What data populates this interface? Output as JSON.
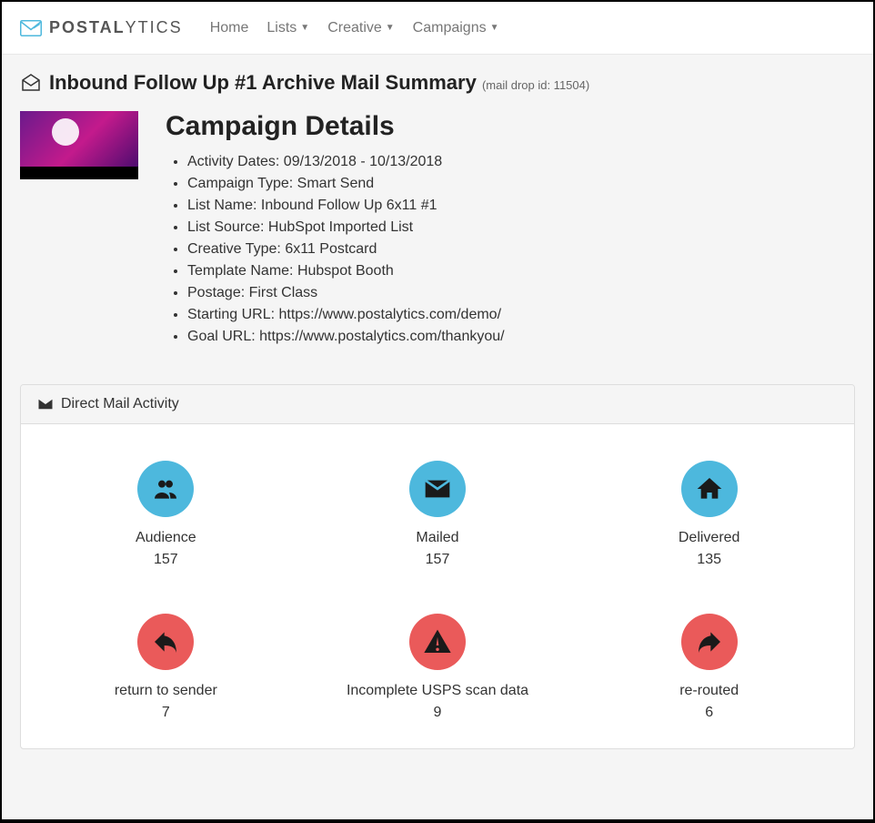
{
  "nav": {
    "home": "Home",
    "lists": "Lists",
    "creative": "Creative",
    "campaigns": "Campaigns"
  },
  "logo": {
    "main": "POSTAL",
    "sub": "YTICS"
  },
  "page": {
    "title": "Inbound Follow Up #1 Archive Mail Summary",
    "subtitle": "(mail drop id: 11504)"
  },
  "details": {
    "heading": "Campaign Details",
    "items": [
      "Activity Dates: 09/13/2018 - 10/13/2018",
      "Campaign Type: Smart Send",
      "List Name: Inbound Follow Up 6x11 #1",
      "List Source: HubSpot Imported List",
      "Creative Type: 6x11 Postcard",
      "Template Name: Hubspot Booth",
      "Postage: First Class",
      "Starting URL: https://www.postalytics.com/demo/",
      "Goal URL: https://www.postalytics.com/thankyou/"
    ]
  },
  "panel": {
    "title": "Direct Mail Activity"
  },
  "stats": [
    {
      "label": "Audience",
      "value": "157",
      "color": "blue",
      "icon": "users"
    },
    {
      "label": "Mailed",
      "value": "157",
      "color": "blue",
      "icon": "envelope"
    },
    {
      "label": "Delivered",
      "value": "135",
      "color": "blue",
      "icon": "home"
    },
    {
      "label": "return to sender",
      "value": "7",
      "color": "red",
      "icon": "reply"
    },
    {
      "label": "Incomplete USPS scan data",
      "value": "9",
      "color": "red",
      "icon": "warning"
    },
    {
      "label": "re-routed",
      "value": "6",
      "color": "red",
      "icon": "share"
    }
  ]
}
